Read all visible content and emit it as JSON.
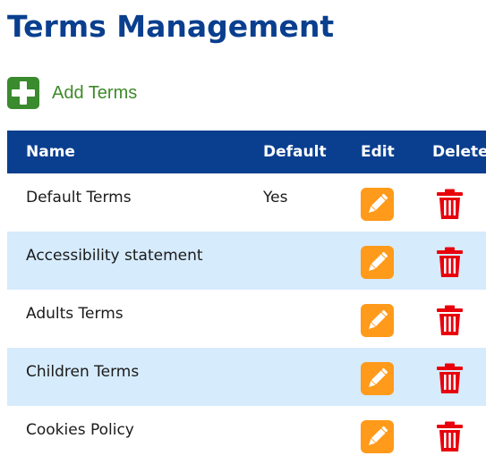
{
  "page": {
    "title": "Terms Management"
  },
  "toolbar": {
    "add_label": "Add Terms",
    "add_icon": "plus-icon",
    "add_icon_color": "#3a8a2e"
  },
  "table": {
    "header_color": "#0a3f8f",
    "alt_row_color": "#d6ebfc",
    "columns": {
      "name": "Name",
      "default": "Default",
      "edit": "Edit",
      "delete": "Delete"
    },
    "edit_icon": "pencil-icon",
    "edit_color": "#ff9a1a",
    "delete_icon": "trash-icon",
    "delete_color": "#e8000b",
    "rows": [
      {
        "name": "Default Terms",
        "default": "Yes"
      },
      {
        "name": "Accessibility statement",
        "default": ""
      },
      {
        "name": "Adults Terms",
        "default": ""
      },
      {
        "name": "Children Terms",
        "default": ""
      },
      {
        "name": "Cookies Policy",
        "default": ""
      }
    ]
  }
}
